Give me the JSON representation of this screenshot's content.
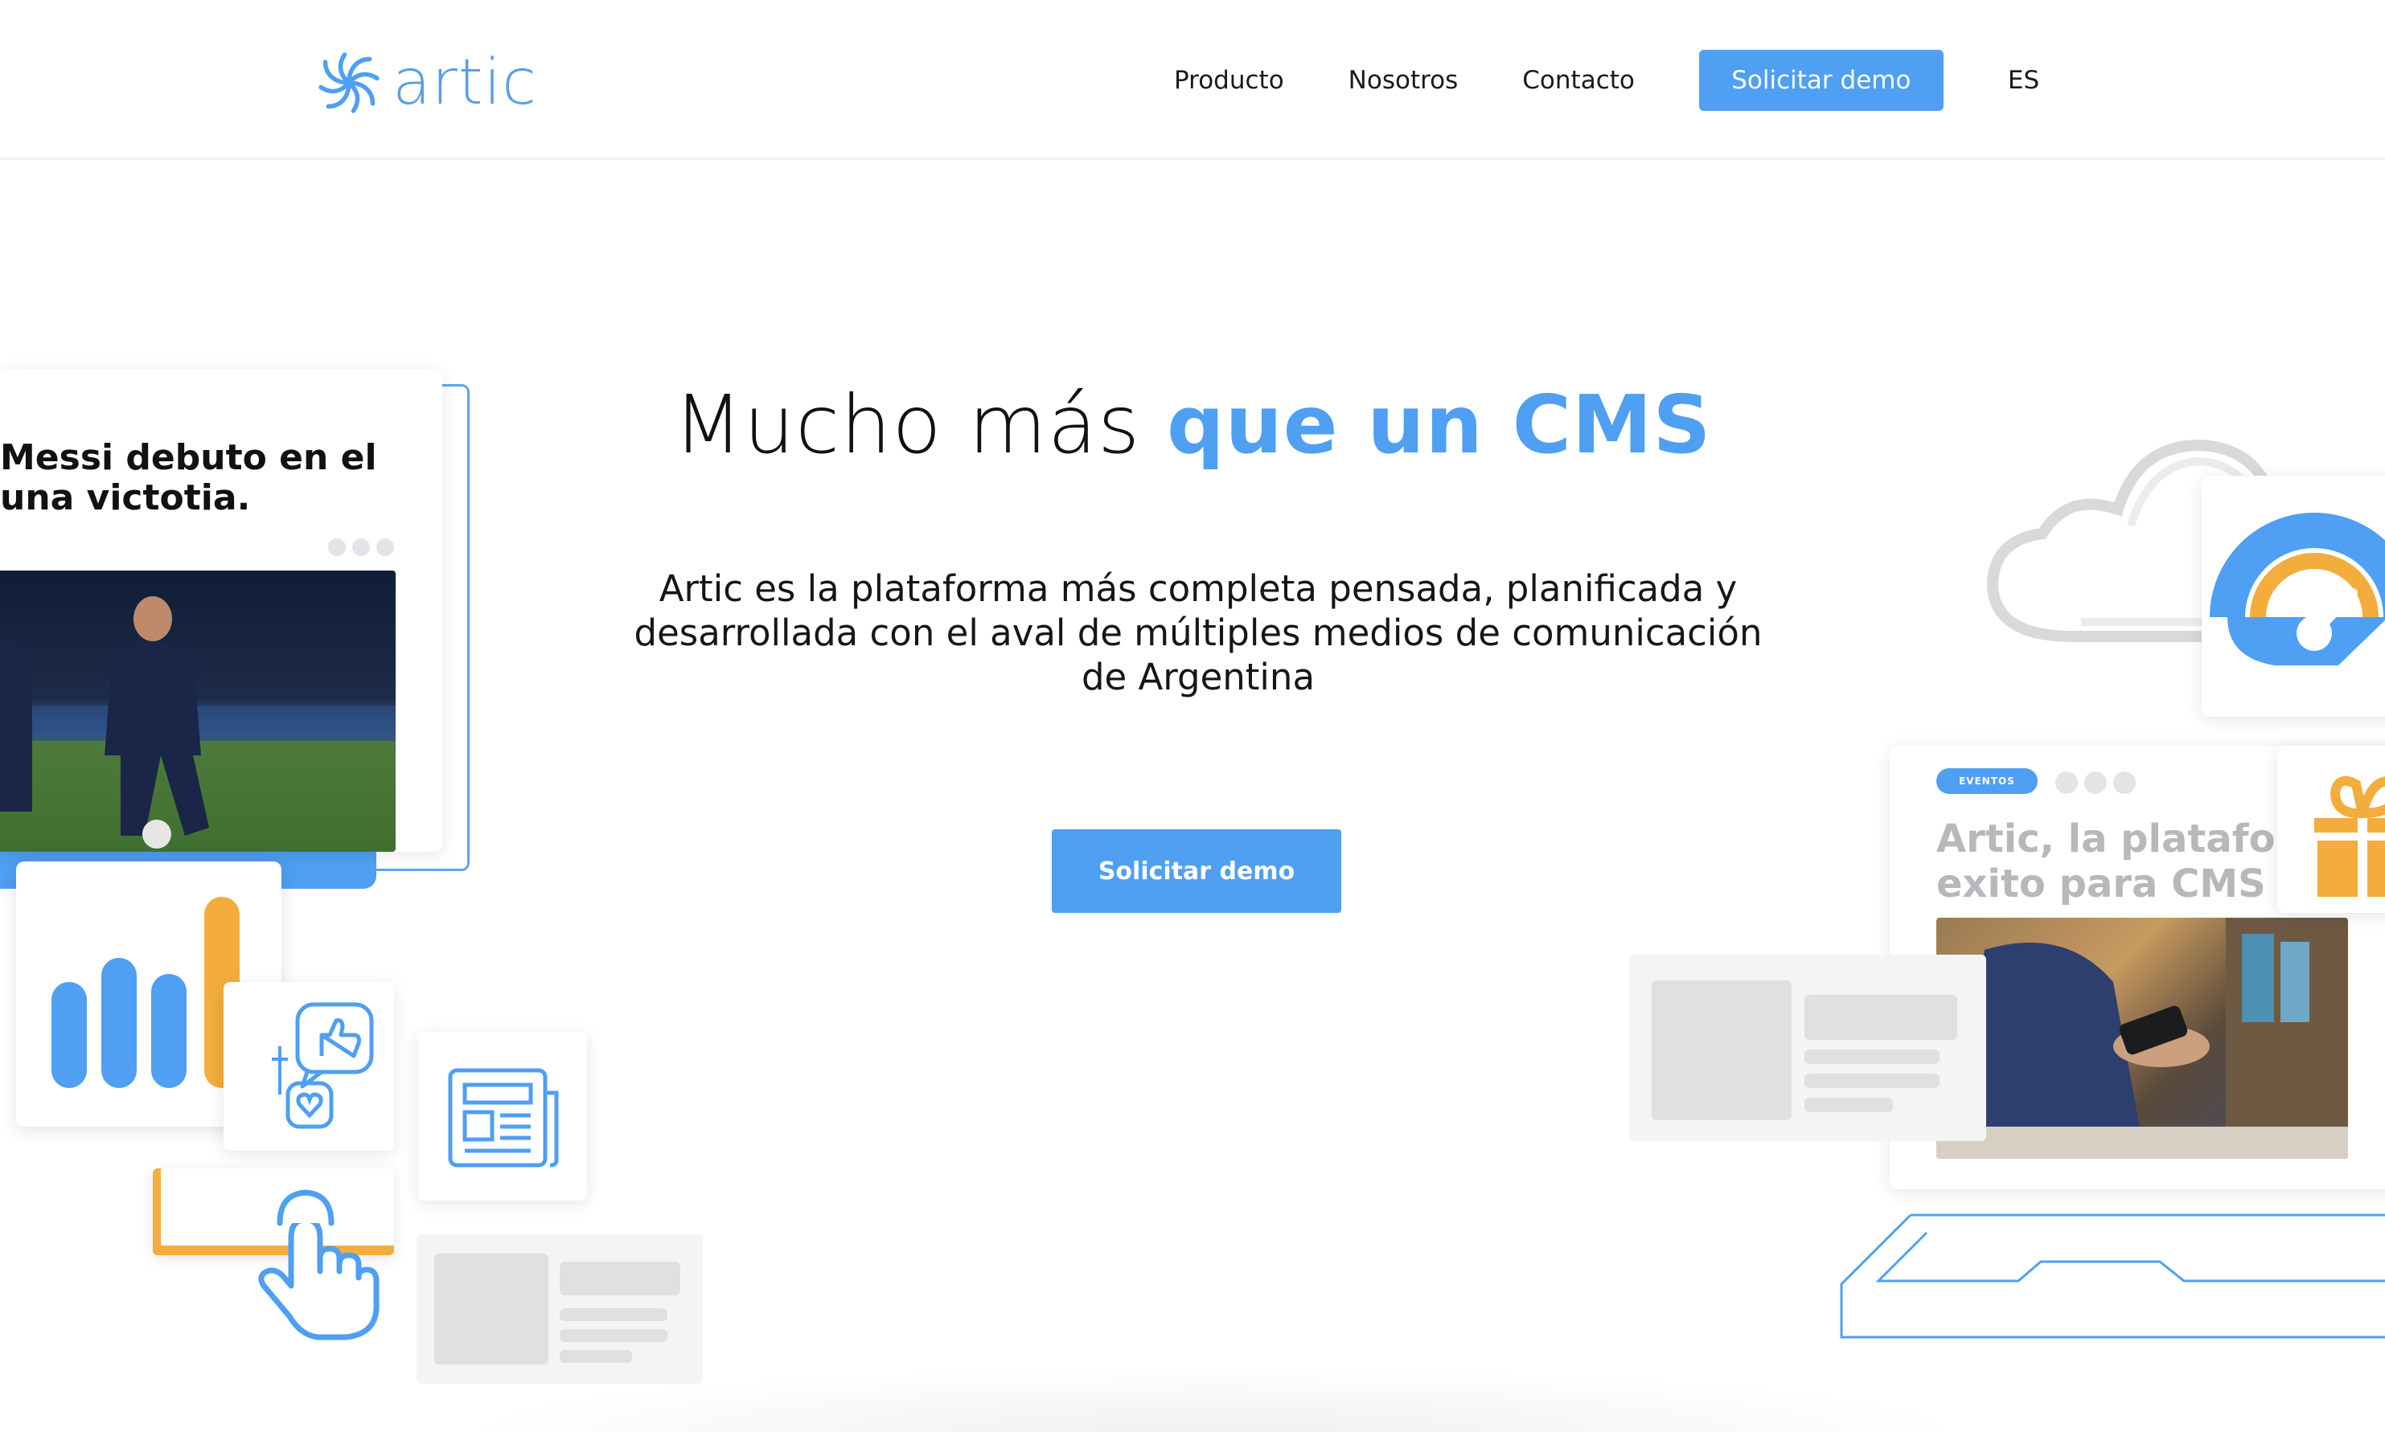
{
  "brand": {
    "name": "artic",
    "accent_color": "#4f9ff2",
    "secondary_color": "#f3ad3d"
  },
  "nav": {
    "items": [
      "Producto",
      "Nosotros",
      "Contacto"
    ],
    "demo_label": "Solicitar demo",
    "language": "ES"
  },
  "hero": {
    "title_plain": "Mucho más ",
    "title_accent": "que un CMS",
    "subtitle": "Artic es la plataforma más completa pensada, planificada y desarrollada con el aval de múltiples medios de comunicación de Argentina",
    "cta_label": "Solicitar demo"
  },
  "illustrations": {
    "news_card": {
      "headline_line1": "Messi debuto en el",
      "headline_line2": "una victotia."
    },
    "article_card": {
      "badge": "EVENTOS",
      "title_line1": "Artic, la plataforma",
      "title_line2": "exito para CMS"
    },
    "icons": [
      "swirl-logo-icon",
      "bar-chart-icon",
      "thumbs-up-icon",
      "heart-icon",
      "newspaper-icon",
      "pointer-hand-icon",
      "cloud-icon",
      "speedometer-icon",
      "gift-icon",
      "laptop-icon"
    ]
  }
}
